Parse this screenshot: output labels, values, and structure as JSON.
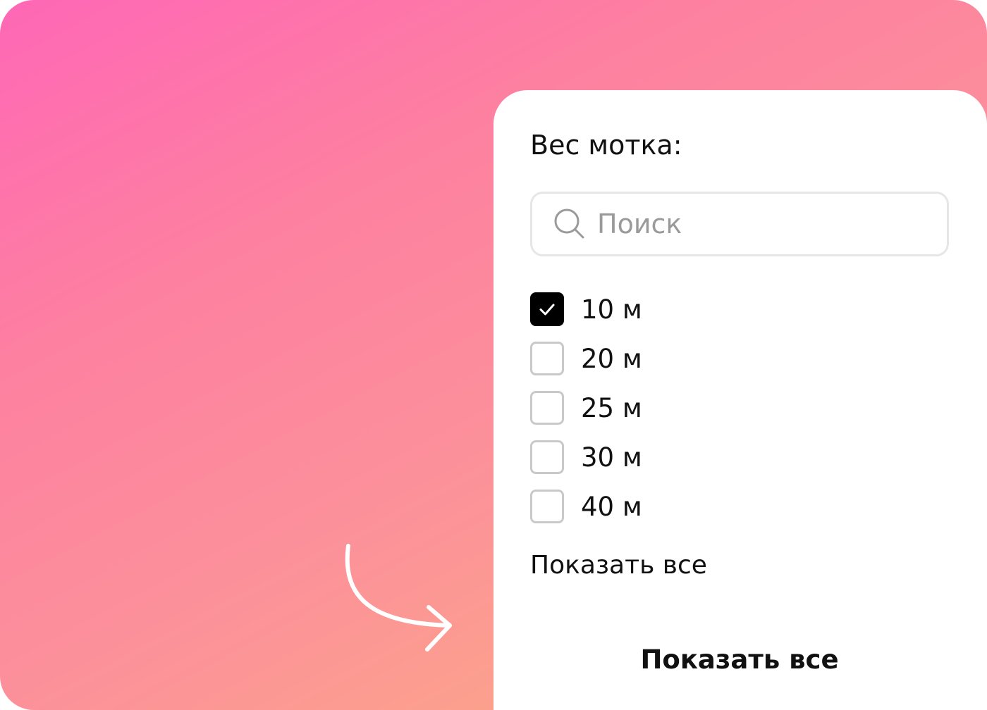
{
  "filter": {
    "title": "Вес мотка:",
    "search": {
      "placeholder": "Поиск",
      "value": "",
      "icon": "search-icon"
    },
    "options": [
      {
        "label": "10 м",
        "checked": true
      },
      {
        "label": "20 м",
        "checked": false
      },
      {
        "label": "25 м",
        "checked": false
      },
      {
        "label": "30 м",
        "checked": false
      },
      {
        "label": "40 м",
        "checked": false
      }
    ],
    "show_all_link": "Показать все",
    "show_all_button": "Показать все"
  },
  "colors": {
    "gradient_start": "#fe67b6",
    "gradient_end": "#fdb080",
    "checkbox_checked": "#000000",
    "checkbox_border": "#c9c9c9",
    "search_border": "#e6e6e6",
    "placeholder": "#9a9a9a"
  }
}
